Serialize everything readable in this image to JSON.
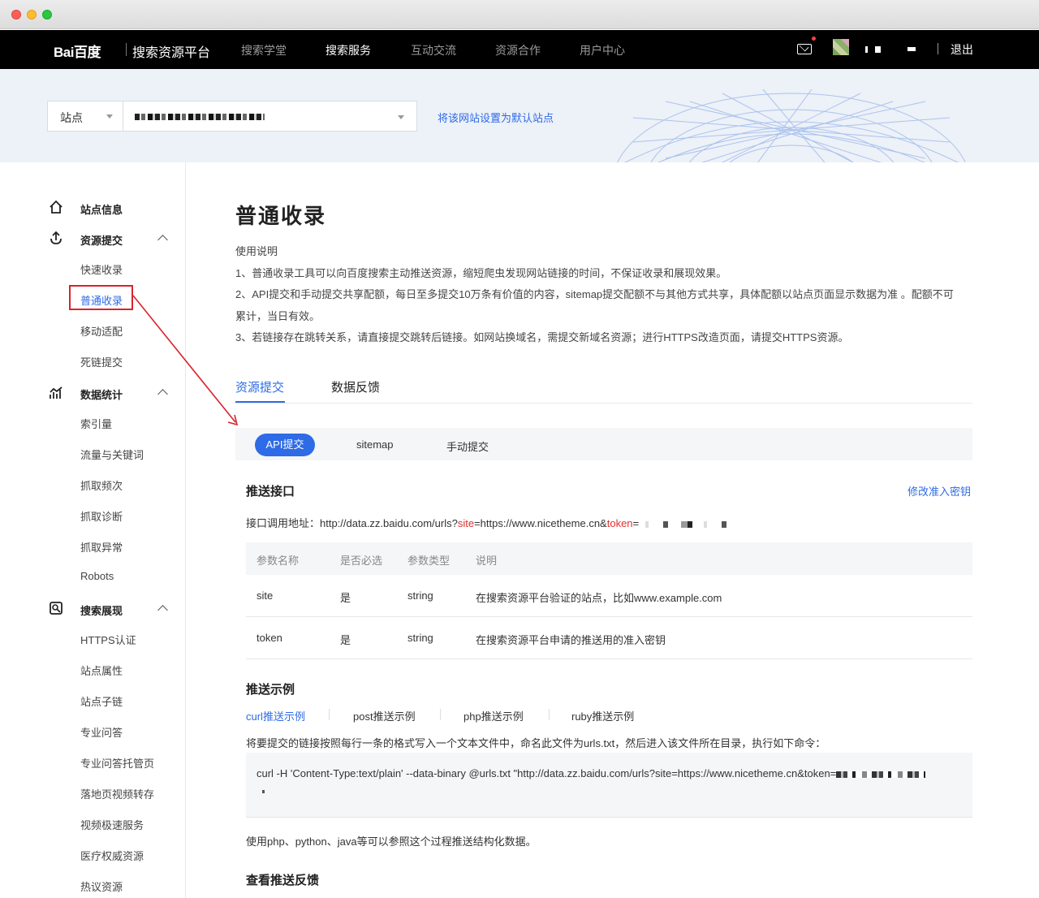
{
  "header": {
    "logo": "Bai百度",
    "platform": "搜索资源平台",
    "nav": [
      "搜索学堂",
      "搜索服务",
      "互动交流",
      "资源合作",
      "用户中心"
    ],
    "active_nav": "搜索服务",
    "logout": "退出"
  },
  "banner": {
    "site_label": "站点",
    "default_link": "将该网站设置为默认站点"
  },
  "sidebar": {
    "groups": [
      {
        "label": "站点信息",
        "icon": "home-icon"
      },
      {
        "label": "资源提交",
        "icon": "submit-icon",
        "items": [
          "快速收录",
          "普通收录",
          "移动适配",
          "死链提交"
        ]
      },
      {
        "label": "数据统计",
        "icon": "stats-icon",
        "items": [
          "索引量",
          "流量与关键词",
          "抓取频次",
          "抓取诊断",
          "抓取异常",
          "Robots"
        ]
      },
      {
        "label": "搜索展现",
        "icon": "search-display-icon",
        "items": [
          "HTTPS认证",
          "站点属性",
          "站点子链",
          "专业问答",
          "专业问答托管页",
          "落地页视频转存",
          "视频极速服务",
          "医疗权威资源",
          "热议资源"
        ]
      }
    ],
    "active_item": "普通收录"
  },
  "main": {
    "title": "普通收录",
    "desc_title": "使用说明",
    "desc_lines": [
      "1、普通收录工具可以向百度搜索主动推送资源，缩短爬虫发现网站链接的时间，不保证收录和展现效果。",
      "2、API提交和手动提交共享配额，每日至多提交10万条有价值的内容，sitemap提交配额不与其他方式共享，具体配额以站点页面显示数据为准 。配额不可",
      "累计，当日有效。",
      "3、若链接存在跳转关系，请直接提交跳转后链接。如网站换域名，需提交新域名资源；进行HTTPS改造页面，请提交HTTPS资源。"
    ],
    "tabs": [
      "资源提交",
      "数据反馈"
    ],
    "subtabs": [
      "API提交",
      "sitemap",
      "手动提交"
    ],
    "push_section": {
      "title": "推送接口",
      "modify_link": "修改准入密钥",
      "api_prefix": "接口调用地址：http://data.zz.baidu.com/urls?",
      "api_site_key": "site",
      "api_mid": "=https://www.nicetheme.cn&",
      "api_token_key": "token",
      "api_eq": "="
    },
    "table": {
      "headers": [
        "参数名称",
        "是否必选",
        "参数类型",
        "说明"
      ],
      "rows": [
        [
          "site",
          "是",
          "string",
          "在搜索资源平台验证的站点，比如www.example.com"
        ],
        [
          "token",
          "是",
          "string",
          "在搜索资源平台申请的推送用的准入密钥"
        ]
      ]
    },
    "example_section": {
      "title": "推送示例",
      "tabs": [
        "curl推送示例",
        "post推送示例",
        "php推送示例",
        "ruby推送示例"
      ],
      "desc": "将要提交的链接按照每行一条的格式写入一个文本文件中，命名此文件为urls.txt，然后进入该文件所在目录，执行如下命令：",
      "code": "curl -H 'Content-Type:text/plain' --data-binary @urls.txt \"http://data.zz.baidu.com/urls?site=https://www.nicetheme.cn&token=",
      "after": "使用php、python、java等可以参照这个过程推送结构化数据。"
    },
    "feedback_title": "查看推送反馈"
  },
  "colors": {
    "accent": "#2e6be6",
    "annotation": "#d9232e",
    "topbar": "#000000"
  }
}
